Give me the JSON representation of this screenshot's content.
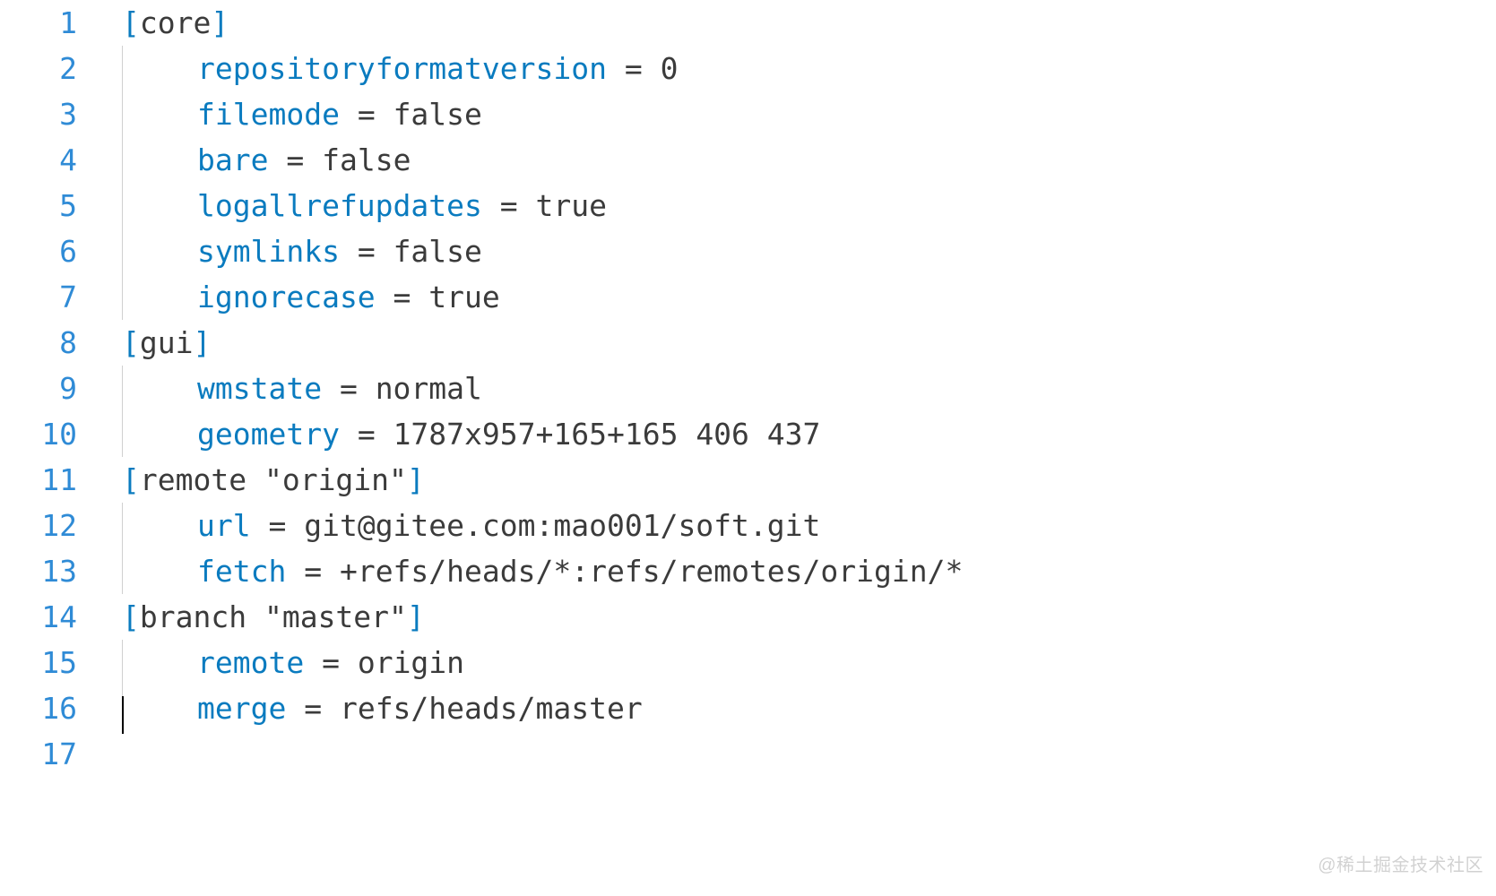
{
  "watermark": "@稀土掘金技术社区",
  "lines": [
    {
      "n": "1",
      "indent": false,
      "guide": false,
      "type": "section",
      "open": "[",
      "name": "core",
      "str": "",
      "close": "]"
    },
    {
      "n": "2",
      "indent": true,
      "guide": true,
      "type": "kv",
      "key": "repositoryformatversion",
      "eq": " = ",
      "val": "0"
    },
    {
      "n": "3",
      "indent": true,
      "guide": true,
      "type": "kv",
      "key": "filemode",
      "eq": " = ",
      "val": "false"
    },
    {
      "n": "4",
      "indent": true,
      "guide": true,
      "type": "kv",
      "key": "bare",
      "eq": " = ",
      "val": "false"
    },
    {
      "n": "5",
      "indent": true,
      "guide": true,
      "type": "kv",
      "key": "logallrefupdates",
      "eq": " = ",
      "val": "true"
    },
    {
      "n": "6",
      "indent": true,
      "guide": true,
      "type": "kv",
      "key": "symlinks",
      "eq": " = ",
      "val": "false"
    },
    {
      "n": "7",
      "indent": true,
      "guide": true,
      "type": "kv",
      "key": "ignorecase",
      "eq": " = ",
      "val": "true"
    },
    {
      "n": "8",
      "indent": false,
      "guide": false,
      "type": "section",
      "open": "[",
      "name": "gui",
      "str": "",
      "close": "]"
    },
    {
      "n": "9",
      "indent": true,
      "guide": true,
      "type": "kv",
      "key": "wmstate",
      "eq": " = ",
      "val": "normal"
    },
    {
      "n": "10",
      "indent": true,
      "guide": true,
      "type": "kv",
      "key": "geometry",
      "eq": " = ",
      "val": "1787x957+165+165 406 437"
    },
    {
      "n": "11",
      "indent": false,
      "guide": false,
      "type": "section",
      "open": "[",
      "name": "remote",
      "str": " \"origin\"",
      "close": "]"
    },
    {
      "n": "12",
      "indent": true,
      "guide": true,
      "type": "kv",
      "key": "url",
      "eq": " = ",
      "val": "git@gitee.com:mao001/soft.git"
    },
    {
      "n": "13",
      "indent": true,
      "guide": true,
      "type": "kv",
      "key": "fetch",
      "eq": " = ",
      "val": "+refs/heads/*:refs/remotes/origin/*"
    },
    {
      "n": "14",
      "indent": false,
      "guide": false,
      "type": "section",
      "open": "[",
      "name": "branch",
      "str": " \"master\"",
      "close": "]"
    },
    {
      "n": "15",
      "indent": true,
      "guide": true,
      "type": "kv",
      "key": "remote",
      "eq": " = ",
      "val": "origin"
    },
    {
      "n": "16",
      "indent": true,
      "guide": true,
      "type": "kv",
      "key": "merge",
      "eq": " = ",
      "val": "refs/heads/master"
    },
    {
      "n": "17",
      "indent": false,
      "guide": true,
      "type": "cursor"
    }
  ]
}
